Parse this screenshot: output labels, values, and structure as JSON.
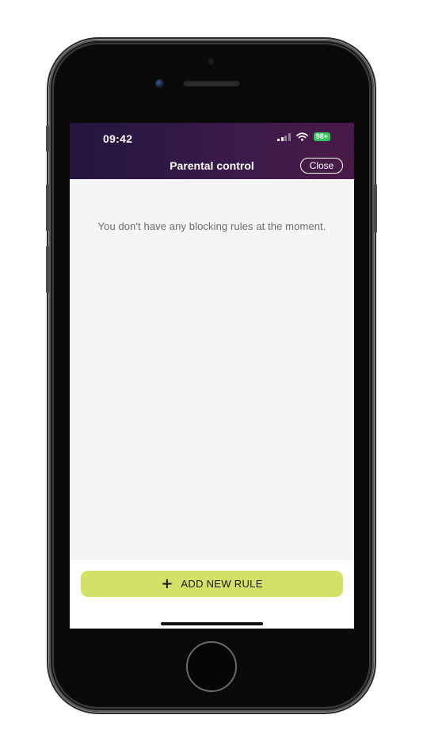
{
  "status_bar": {
    "time": "09:42",
    "battery": "98+",
    "icons": [
      "signal-icon",
      "wifi-icon",
      "battery-icon"
    ]
  },
  "header": {
    "title": "Parental control",
    "close_label": "Close"
  },
  "content": {
    "empty_message": "You don't have any blocking rules at the moment."
  },
  "footer": {
    "add_button_label": "ADD NEW RULE",
    "add_button_icon": "plus-icon"
  },
  "colors": {
    "header_start": "#23163f",
    "header_end": "#4a1a48",
    "accent_button": "#d2e266",
    "battery_green": "#33c759",
    "background": "#f5f5f5"
  }
}
